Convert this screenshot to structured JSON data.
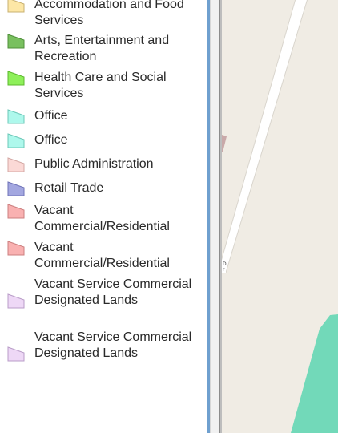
{
  "legend": {
    "items": [
      {
        "label": "Accommodation and Food Services",
        "fill": "#fde7a6",
        "stroke": "#c8b070"
      },
      {
        "label": "Arts, Entertainment and Recreation",
        "fill": "#79c05f",
        "stroke": "#4f8f3a"
      },
      {
        "label": "Health Care and Social Services",
        "fill": "#8ef05a",
        "stroke": "#5cb82e"
      },
      {
        "label": "Office",
        "fill": "#aef8ec",
        "stroke": "#6cc8b8"
      },
      {
        "label": "Office",
        "fill": "#aef8ec",
        "stroke": "#6cc8b8"
      },
      {
        "label": "Public Administration",
        "fill": "#fbd9d6",
        "stroke": "#d4a8a4"
      },
      {
        "label": "Retail Trade",
        "fill": "#a3a7e0",
        "stroke": "#6f73b8"
      },
      {
        "label": "Vacant Commercial/Residential",
        "fill": "#f9b1b1",
        "stroke": "#cc7f7f"
      },
      {
        "label": "Vacant Commercial/Residential",
        "fill": "#f9b1b1",
        "stroke": "#cc7f7f"
      },
      {
        "label": "Vacant Service Commercial Designated Lands",
        "fill": "#eed8f6",
        "stroke": "#b99dc8"
      },
      {
        "label": "Vacant Service Commercial Designated Lands",
        "fill": "#eed8f6",
        "stroke": "#b99dc8"
      }
    ]
  },
  "map": {
    "background_color": "#f0ece4",
    "road_color": "#ffffff",
    "parcel_color": "#72d9b9"
  }
}
